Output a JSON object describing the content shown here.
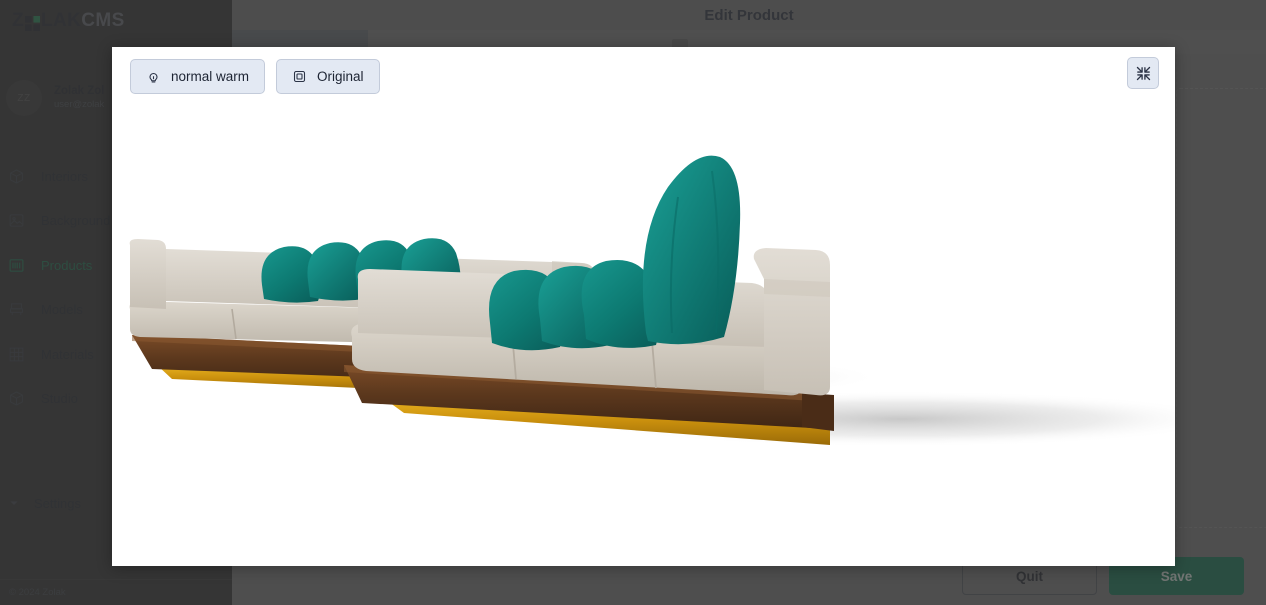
{
  "app": {
    "brand_z": "Z",
    "brand_lak": "LAK",
    "brand_cms": "CMS",
    "brand_mark_icon": "grid-logo-icon",
    "accent_color": "#17694a",
    "save_color": "#0e6b4a"
  },
  "user": {
    "avatar_initials": "ZZ",
    "name": "Zolak Zol",
    "email": "user@zolak"
  },
  "sidebar": {
    "items": [
      {
        "label": "Interiors",
        "icon": "cube-icon",
        "active": false
      },
      {
        "label": "Background",
        "icon": "image-icon",
        "active": false
      },
      {
        "label": "Products",
        "icon": "barcode-icon",
        "active": true
      },
      {
        "label": "Models",
        "icon": "armchair-icon",
        "active": false
      },
      {
        "label": "Materials",
        "icon": "grid-icon",
        "active": false
      },
      {
        "label": "Studio",
        "icon": "cube-icon",
        "active": false
      }
    ],
    "settings_label": "Settings",
    "settings_icon": "chevron-down-icon",
    "footer": "© 2024 Zolak"
  },
  "page": {
    "title": "Edit Product",
    "quit_label": "Quit",
    "save_label": "Save"
  },
  "viewer": {
    "lighting_chip": {
      "label": "normal warm",
      "icon": "lightbulb-icon"
    },
    "variant_chip": {
      "label": "Original",
      "icon": "layers-copy-icon"
    },
    "collapse_icon": "collapse-arrows-icon",
    "product": {
      "name": "sectional-sofa",
      "upholstery_color": "#d6d0c7",
      "pillow_color": "#0f7a72",
      "wood_color": "#5d3a1f",
      "plinth_color": "#d39b13"
    }
  }
}
